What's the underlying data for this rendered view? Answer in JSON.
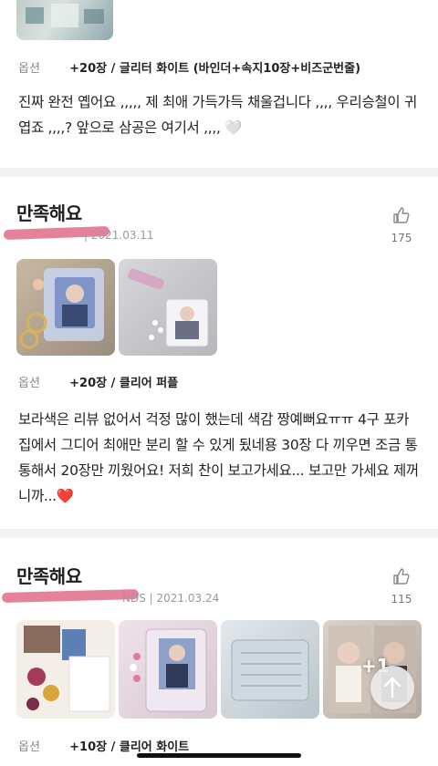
{
  "review1": {
    "option_label": "옵션",
    "option_value": "+20장 / 글리터 화이트 (바인더+속지10장+비즈군번줄)",
    "text": "진짜 완전 옙어요 ,,,,, 제 최애 가득가득 채울겁니다 ,,,, 우리승철이 귀엽죠 ,,,,? 앞으로 삼공은 여기서 ,,,, 🤍"
  },
  "review2": {
    "title": "만족해요",
    "date": "| 2021.03.11",
    "like_count": "175",
    "option_label": "옵션",
    "option_value": "+20장 / 클리어 퍼플",
    "text": "보라색은 리뷰 없어서 걱정 많이 했는데 색감 짱예뻐요ㅠㅠ 4구 포카집에서 그디어 최애만 분리 할 수 있게 됬네용 30장 다 끼우면 조금 통통해서 20장만 끼웠어요! 저희 찬이 보고가세요... 보고만 가세요 제꺼니까...❤️"
  },
  "review3": {
    "title": "만족해요",
    "date": "NDS | 2021.03.24",
    "like_count": "115",
    "more_photos": "+1",
    "option_label": "옵션",
    "option_value": "+10장 / 클리어 화이트"
  },
  "colors": {
    "scribble": "#e2738f",
    "divider": "#f2f2f2"
  },
  "icons": {
    "like": "thumbs-up-icon",
    "scroll_top": "arrow-up-icon"
  }
}
